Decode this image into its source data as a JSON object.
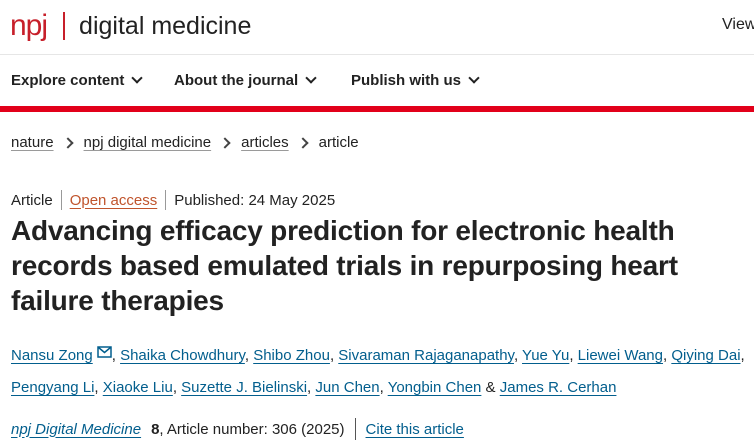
{
  "header": {
    "logo_prefix": "npj",
    "logo_title": "digital medicine",
    "right_link": "View"
  },
  "nav": {
    "items": [
      {
        "label": "Explore content"
      },
      {
        "label": "About the journal"
      },
      {
        "label": "Publish with us"
      }
    ]
  },
  "colors": {
    "brand_red": "#c71f2a",
    "rule_red": "#e2001a",
    "link_blue": "#025e8d",
    "open_access": "#c0542c"
  },
  "breadcrumb": [
    "nature",
    "npj digital medicine",
    "articles",
    "article"
  ],
  "meta": {
    "type": "Article",
    "access": "Open access",
    "published": "Published: 24 May 2025"
  },
  "article": {
    "title": "Advancing efficacy prediction for electronic health records based emulated trials in repurposing heart failure therapies"
  },
  "authors": [
    "Nansu Zong",
    "Shaika Chowdhury",
    "Shibo Zhou",
    "Sivaraman Rajaganapathy",
    "Yue Yu",
    "Liewei Wang",
    "Qiying Dai",
    "Pengyang Li",
    "Xiaoke Liu",
    "Suzette J. Bielinski",
    "Jun Chen",
    "Yongbin Chen",
    "James R. Cerhan"
  ],
  "citation": {
    "journal": "npj Digital Medicine",
    "volume": "8",
    "rest": ", Article number: 306 (2025)",
    "cite_label": "Cite this article"
  }
}
